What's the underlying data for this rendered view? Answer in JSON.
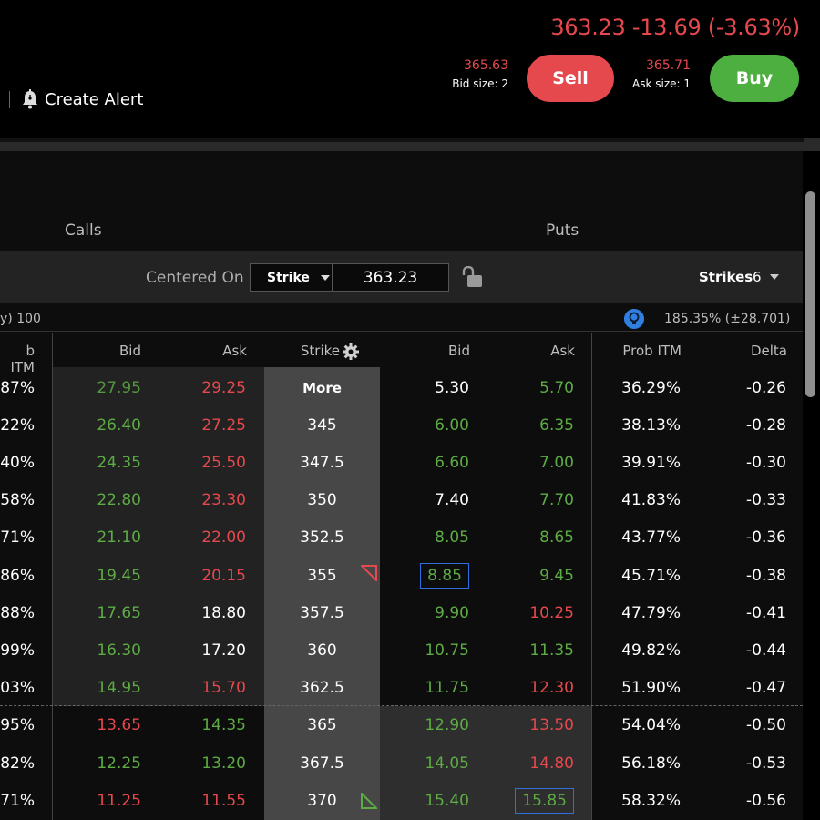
{
  "header": {
    "last": "363.23",
    "change": "-13.69",
    "change_pct": "(-3.63%)",
    "create_alert": "Create Alert",
    "bid_price": "365.63",
    "bid_size": "Bid size: 2",
    "sell_label": "Sell",
    "ask_price": "365.71",
    "ask_size": "Ask size: 1",
    "buy_label": "Buy",
    "colors": {
      "sell": "#e5484d",
      "buy": "#4caf3f",
      "negative": "#e5484d"
    }
  },
  "chain": {
    "calls_label": "Calls",
    "puts_label": "Puts",
    "centered_on_label": "Centered On",
    "centered_on_mode": "Strike",
    "centered_on_value": "363.23",
    "strikes_label": "Strikes",
    "strikes_value": "6",
    "multiplier_text": "y) 100",
    "implied_move": "185.35% (±28.701)",
    "headers": {
      "call_prob_itm": "b ITM",
      "call_bid": "Bid",
      "call_ask": "Ask",
      "strike": "Strike",
      "put_bid": "Bid",
      "put_ask": "Ask",
      "put_prob_itm": "Prob ITM",
      "put_delta": "Delta"
    },
    "rows": [
      {
        "cp": ".87%",
        "cb": "27.95",
        "ca": "29.25",
        "k": "More",
        "pb": "5.30",
        "pa": "5.70",
        "pp": "36.29%",
        "d": "-0.26"
      },
      {
        "cp": ".22%",
        "cb": "26.40",
        "ca": "27.25",
        "k": "345",
        "pb": "6.00",
        "pa": "6.35",
        "pp": "38.13%",
        "d": "-0.28"
      },
      {
        "cp": ".40%",
        "cb": "24.35",
        "ca": "25.50",
        "k": "347.5",
        "pb": "6.60",
        "pa": "7.00",
        "pp": "39.91%",
        "d": "-0.30"
      },
      {
        "cp": ".58%",
        "cb": "22.80",
        "ca": "23.30",
        "k": "350",
        "pb": "7.40",
        "pa": "7.70",
        "pp": "41.83%",
        "d": "-0.33"
      },
      {
        "cp": ".71%",
        "cb": "21.10",
        "ca": "22.00",
        "k": "352.5",
        "pb": "8.05",
        "pa": "8.65",
        "pp": "43.77%",
        "d": "-0.36"
      },
      {
        "cp": ".86%",
        "cb": "19.45",
        "ca": "20.15",
        "k": "355",
        "pb": "8.85",
        "pa": "9.45",
        "pp": "45.71%",
        "d": "-0.38"
      },
      {
        "cp": ".88%",
        "cb": "17.65",
        "ca": "18.80",
        "k": "357.5",
        "pb": "9.90",
        "pa": "10.25",
        "pp": "47.79%",
        "d": "-0.41"
      },
      {
        "cp": ".99%",
        "cb": "16.30",
        "ca": "17.20",
        "k": "360",
        "pb": "10.75",
        "pa": "11.35",
        "pp": "49.82%",
        "d": "-0.44"
      },
      {
        "cp": ".03%",
        "cb": "14.95",
        "ca": "15.70",
        "k": "362.5",
        "pb": "11.75",
        "pa": "12.30",
        "pp": "51.90%",
        "d": "-0.47"
      },
      {
        "cp": ".95%",
        "cb": "13.65",
        "ca": "14.35",
        "k": "365",
        "pb": "12.90",
        "pa": "13.50",
        "pp": "54.04%",
        "d": "-0.50"
      },
      {
        "cp": ".82%",
        "cb": "12.25",
        "ca": "13.20",
        "k": "367.5",
        "pb": "14.05",
        "pa": "14.80",
        "pp": "56.18%",
        "d": "-0.53"
      },
      {
        "cp": ".71%",
        "cb": "11.25",
        "ca": "11.55",
        "k": "370",
        "pb": "15.40",
        "pa": "15.85",
        "pp": "58.32%",
        "d": "-0.56"
      }
    ]
  }
}
